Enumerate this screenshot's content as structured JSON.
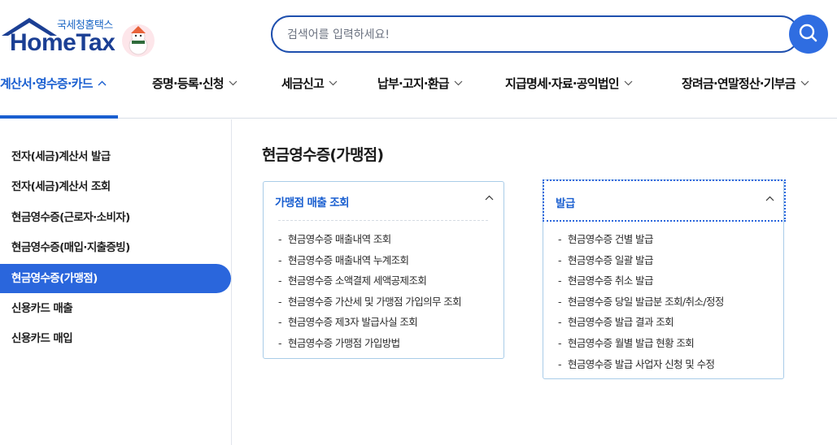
{
  "brand": {
    "name": "HomeTax",
    "subtitle": "국세청홈택스"
  },
  "search": {
    "placeholder": "검색어를 입력하세요!"
  },
  "gnb": [
    {
      "label": "계산서·영수증·카드",
      "active": true
    },
    {
      "label": "증명·등록·신청",
      "active": false
    },
    {
      "label": "세금신고",
      "active": false
    },
    {
      "label": "납부·고지·환급",
      "active": false
    },
    {
      "label": "지급명세·자료·공익법인",
      "active": false
    },
    {
      "label": "장려금·연말정산·기부금",
      "active": false
    }
  ],
  "sidebar": {
    "items": [
      {
        "label": "전자(세금)계산서 발급",
        "active": false
      },
      {
        "label": "전자(세금)계산서 조회",
        "active": false
      },
      {
        "label": "현금영수증(근로자·소비자)",
        "active": false
      },
      {
        "label": "현금영수증(매입·지출증빙)",
        "active": false
      },
      {
        "label": "현금영수증(가맹점)",
        "active": true
      },
      {
        "label": "신용카드 매출",
        "active": false
      },
      {
        "label": "신용카드 매입",
        "active": false
      }
    ]
  },
  "main": {
    "title": "현금영수증(가맹점)",
    "cards": [
      {
        "title": "가맹점 매출 조회",
        "links": [
          "현금영수증 매출내역 조회",
          "현금영수증 매출내역 누계조회",
          "현금영수증 소액결제 세액공제조회",
          "현금영수증 가산세 및 가맹점 가입의무 조회",
          "현금영수증 제3자 발급사실 조회",
          "현금영수증 가맹점 가입방법"
        ]
      },
      {
        "title": "발급",
        "links": [
          "현금영수증 건별 발급",
          "현금영수증 일괄 발급",
          "현금영수증 취소 발급",
          "현금영수증 당일 발급분 조회/취소/정정",
          "현금영수증 발급 결과 조회",
          "현금영수증 월별 발급 현황 조회",
          "현금영수증 발급 사업자 신청 및 수정"
        ]
      }
    ]
  },
  "colors": {
    "accent": "#2a66dc",
    "brand_navy": "#1b3f94",
    "card_border": "#a9cce8"
  }
}
